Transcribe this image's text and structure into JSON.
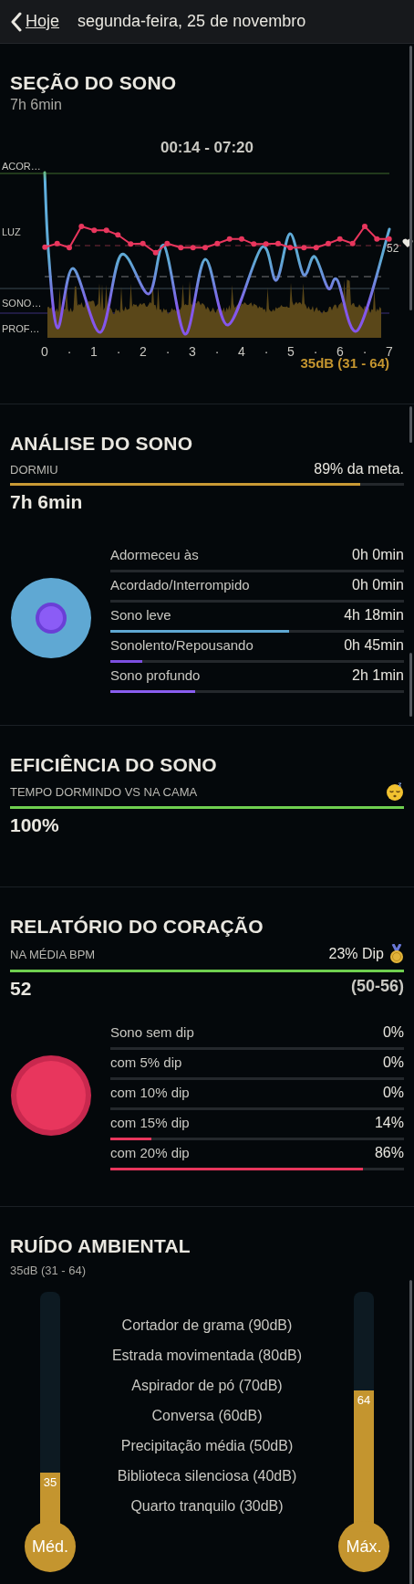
{
  "header": {
    "back_label": "Hoje",
    "title": "segunda-feira, 25 de novembro"
  },
  "session": {
    "title": "SEÇÃO DO SONO",
    "duration": "7h 6min",
    "time_range": "00:14 - 07:20",
    "stage_labels": [
      "ACOR…",
      "LUZ",
      "SONO…",
      "PROF…"
    ],
    "x_labels": [
      "0",
      "·",
      "1",
      "·",
      "2",
      "·",
      "3",
      "·",
      "4",
      "·",
      "5",
      "·",
      "6",
      "·",
      "7"
    ],
    "heart_rate_label": "52",
    "noise_summary": "35dB (31 - 64)"
  },
  "analysis": {
    "title": "ANÁLISE DO SONO",
    "metric_label": "DORMIU",
    "goal_text": "89% da meta.",
    "level": 0.89,
    "total": "7h 6min",
    "stages": [
      {
        "label": "Adormeceu às",
        "value": "0h 0min"
      },
      {
        "label": "Acordado/Interrompido",
        "value": "0h 0min"
      },
      {
        "label": "Sono leve",
        "value": "4h 18min",
        "level": 0.61,
        "color": "#5fa8d3"
      },
      {
        "label": "Sonolento/Repousando",
        "value": "0h 45min",
        "level": 0.11,
        "color": "#7c4fe0"
      },
      {
        "label": "Sono profundo",
        "value": "2h 1min",
        "level": 0.29,
        "color": "#8a5ef0"
      }
    ]
  },
  "efficiency": {
    "title": "EFICIÊNCIA DO SONO",
    "metric_label": "TEMPO DORMINDO VS NA CAMA",
    "level": 1,
    "value": "100%"
  },
  "heart": {
    "title": "RELATÓRIO DO CORAÇÃO",
    "metric_label": "NA MÉDIA BPM",
    "dip": "23% Dip",
    "level": 1,
    "value": "52",
    "range": "(50-56)",
    "rows": [
      {
        "label": "Sono sem dip",
        "value": "0%"
      },
      {
        "label": "com 5% dip",
        "value": "0%"
      },
      {
        "label": "com 10% dip",
        "value": "0%"
      },
      {
        "label": "com 15% dip",
        "value": "14%",
        "level": 0.14
      },
      {
        "label": "com 20% dip",
        "value": "86%",
        "level": 0.86
      }
    ]
  },
  "noise": {
    "title": "RUÍDO AMBIENTAL",
    "summary": "35dB (31 - 64)",
    "meters": [
      {
        "label": "Méd.",
        "reading": "35",
        "level": 0.23
      },
      {
        "label": "Máx.",
        "reading": "64",
        "level": 0.58
      }
    ],
    "references": [
      "Cortador de grama (90dB)",
      "Estrada movimentada (80dB)",
      "Aspirador de pó (70dB)",
      "Conversa (60dB)",
      "Precipitação média (50dB)",
      "Biblioteca silenciosa (40dB)",
      "Quarto tranquilo (30dB)"
    ]
  }
}
